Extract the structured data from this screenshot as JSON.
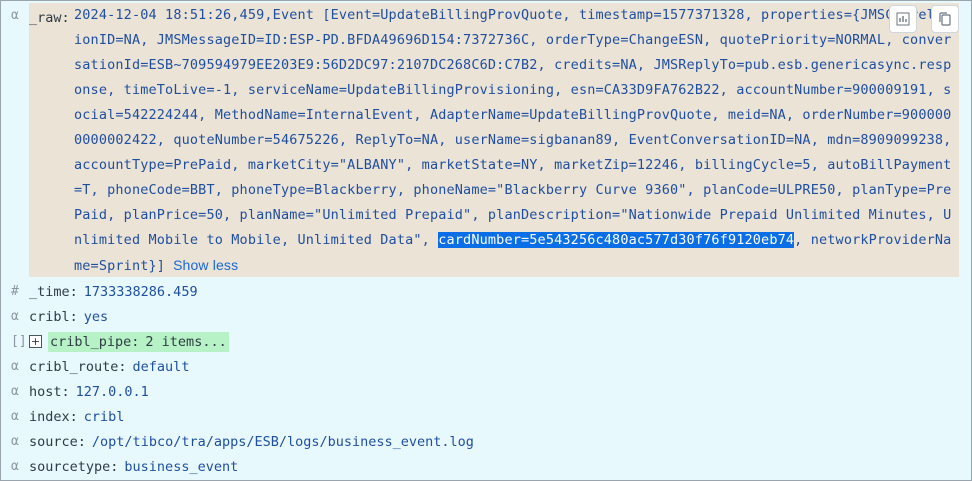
{
  "toolbar": {
    "chart_icon": "chart-icon",
    "copy_icon": "copy-icon"
  },
  "raw": {
    "type_symbol": "α",
    "key": "_raw",
    "text_before": "2024-12-04 18:51:26,459,Event [Event=UpdateBillingProvQuote, timestamp=1577371328, properties={JMSCorrelationID=NA, JMSMessageID=ID:ESP-PD.BFDA49696D154:7372736C, orderType=ChangeESN, quotePriority=NORMAL, conversationId=ESB~709594979EE203E9:56D2DC97:2107DC268C6D:C7B2, credits=NA, JMSReplyTo=pub.esb.genericasync.response, timeToLive=-1, serviceName=UpdateBillingProvisioning, esn=CA33D9FA762B22, accountNumber=900009191, social=542224244, MethodName=InternalEvent, AdapterName=UpdateBillingProvQuote, meid=NA, orderNumber=9000000000002422, quoteNumber=54675226, ReplyTo=NA, userName=sigbanan89, EventConversationID=NA, mdn=8909099238, accountType=PrePaid, marketCity=\"ALBANY\", marketState=NY, marketZip=12246, billingCycle=5, autoBillPayment=T, phoneCode=BBT, phoneType=Blackberry, phoneName=\"Blackberry Curve 9360\", planCode=ULPRE50, planType=PrePaid, planPrice=50, planName=\"Unlimited Prepaid\", planDescription=\"Nationwide Prepaid Unlimited Minutes, Unlimited Mobile to Mobile, Unlimited Data\", ",
    "highlighted": "cardNumber=5e543256c480ac577d30f76f9120eb74",
    "text_after": ", networkProviderName=Sprint}]",
    "show_less_label": "Show less"
  },
  "fields": [
    {
      "type_symbol": "#",
      "key": "_time",
      "value": "1733338286.459"
    },
    {
      "type_symbol": "α",
      "key": "cribl",
      "value": "yes"
    },
    {
      "type_symbol": "[]",
      "key": "cribl_pipe",
      "value": "2 items...",
      "expand_symbol": "+"
    },
    {
      "type_symbol": "α",
      "key": "cribl_route",
      "value": "default"
    },
    {
      "type_symbol": "α",
      "key": "host",
      "value": "127.0.0.1"
    },
    {
      "type_symbol": "α",
      "key": "index",
      "value": "cribl"
    },
    {
      "type_symbol": "α",
      "key": "source",
      "value": "/opt/tibco/tra/apps/ESB/logs/business_event.log"
    },
    {
      "type_symbol": "α",
      "key": "sourcetype",
      "value": "business_event"
    }
  ]
}
